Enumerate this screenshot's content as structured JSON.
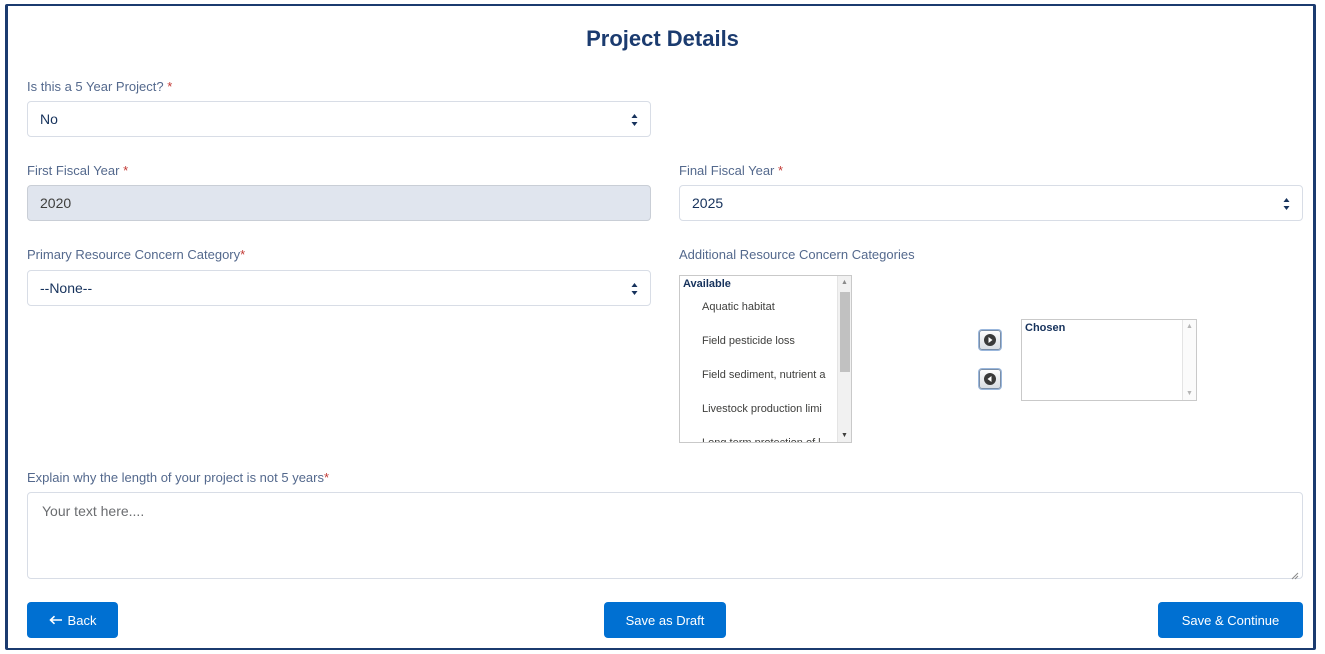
{
  "page": {
    "title": "Project Details"
  },
  "five_year": {
    "label": "Is this a 5 Year Project?",
    "required_mark": "*",
    "value": "No"
  },
  "first_fiscal": {
    "label": "First Fiscal Year",
    "required_mark": "*",
    "value": "2020"
  },
  "final_fiscal": {
    "label": "Final Fiscal Year",
    "required_mark": "*",
    "value": "2025"
  },
  "primary_concern": {
    "label": "Primary Resource Concern Category",
    "required_mark": "*",
    "value": "--None--"
  },
  "additional_concern": {
    "label": "Additional Resource Concern Categories",
    "available_header": "Available",
    "available_items": [
      "Aquatic habitat",
      "Field pesticide loss",
      "Field sediment, nutrient a",
      "Livestock production limi",
      "Long term protection of l"
    ],
    "chosen_header": "Chosen"
  },
  "explain": {
    "label": "Explain why the length of your project is not 5 years",
    "required_mark": "*",
    "placeholder": "Your text here...."
  },
  "actions": {
    "back": "Back",
    "save_draft": "Save as Draft",
    "save_continue": "Save & Continue"
  },
  "colors": {
    "primary": "#0070d2",
    "title": "#1b3b6f",
    "required": "#c23934"
  }
}
